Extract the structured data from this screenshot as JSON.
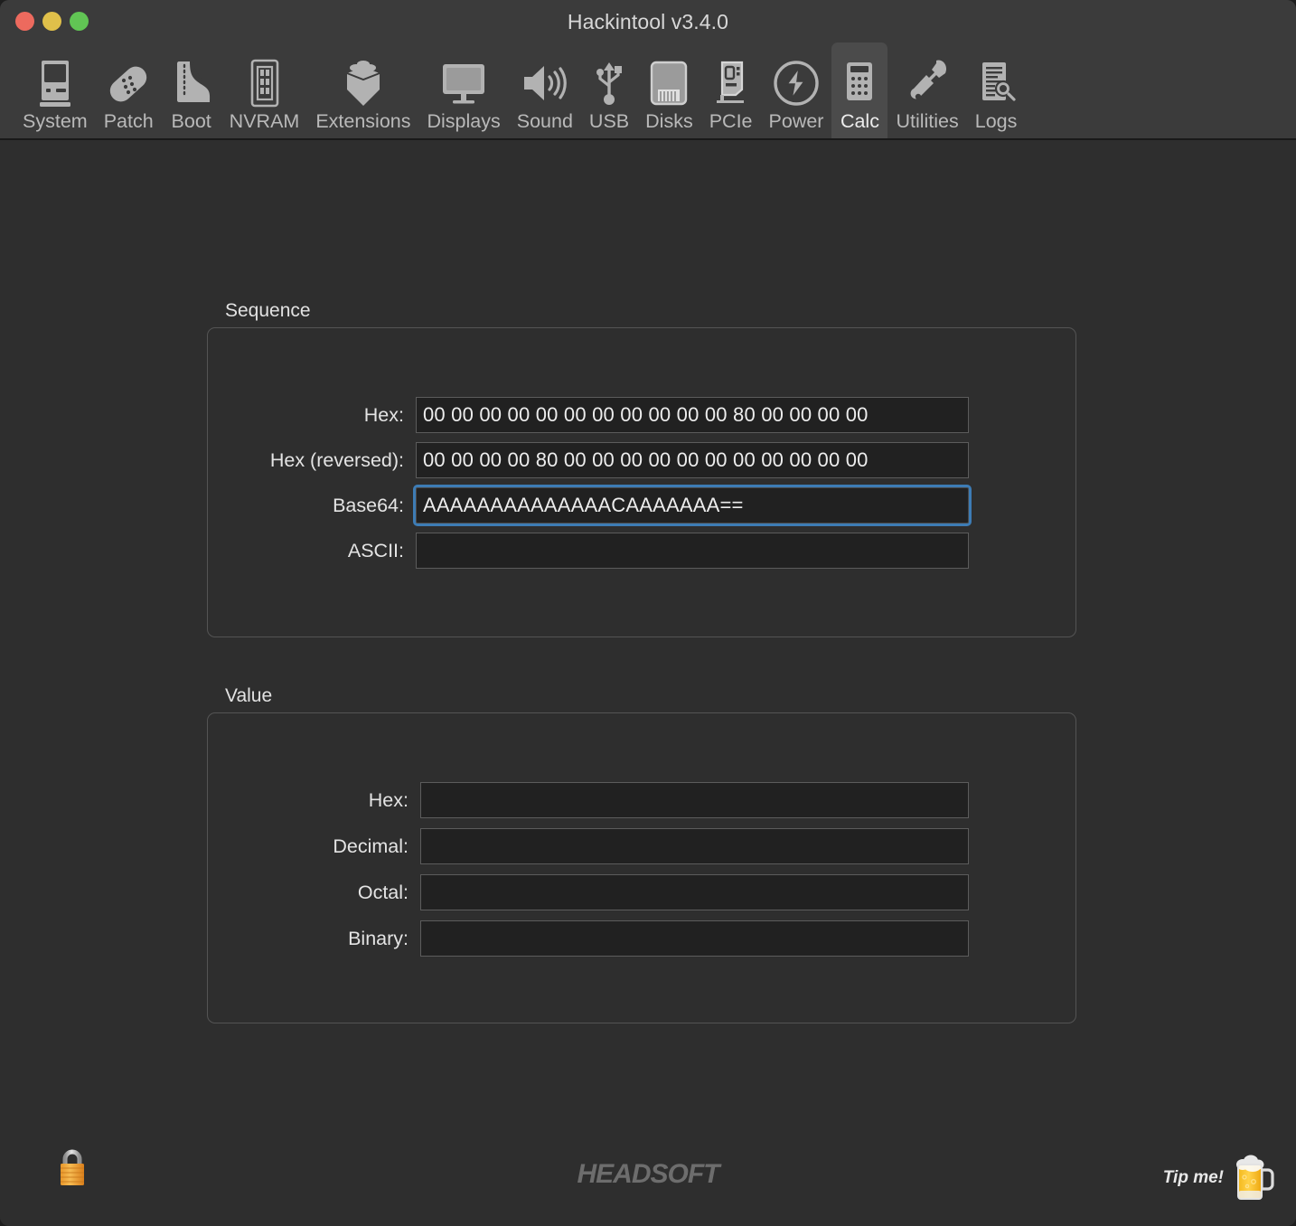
{
  "window": {
    "title": "Hackintool v3.4.0",
    "traffic_lights": [
      {
        "name": "close",
        "color": "#ed6a5e"
      },
      {
        "name": "minimize",
        "color": "#e0c04a"
      },
      {
        "name": "maximize",
        "color": "#61c554"
      }
    ]
  },
  "toolbar": {
    "active": "Calc",
    "items": [
      {
        "label": "System",
        "icon": "computer-icon"
      },
      {
        "label": "Patch",
        "icon": "bandage-icon"
      },
      {
        "label": "Boot",
        "icon": "boot-icon"
      },
      {
        "label": "NVRAM",
        "icon": "memory-chip-icon"
      },
      {
        "label": "Extensions",
        "icon": "lego-brick-icon"
      },
      {
        "label": "Displays",
        "icon": "monitor-icon"
      },
      {
        "label": "Sound",
        "icon": "speaker-icon"
      },
      {
        "label": "USB",
        "icon": "usb-icon"
      },
      {
        "label": "Disks",
        "icon": "hard-drive-icon"
      },
      {
        "label": "PCIe",
        "icon": "pcie-card-icon"
      },
      {
        "label": "Power",
        "icon": "lightning-bolt-icon"
      },
      {
        "label": "Calc",
        "icon": "calculator-icon"
      },
      {
        "label": "Utilities",
        "icon": "wrench-icon"
      },
      {
        "label": "Logs",
        "icon": "document-search-icon"
      }
    ]
  },
  "sequence": {
    "title": "Sequence",
    "rows": [
      {
        "label": "Hex:",
        "value": "00 00 00 00 00 00 00 00 00 00 00 80 00 00 00 00",
        "focused": false
      },
      {
        "label": "Hex (reversed):",
        "value": "00 00 00 00 80 00 00 00 00 00 00 00 00 00 00 00",
        "focused": false
      },
      {
        "label": "Base64:",
        "value": "AAAAAAAAAAAAAACAAAAAAA==",
        "focused": true
      },
      {
        "label": "ASCII:",
        "value": "",
        "focused": false
      }
    ]
  },
  "value": {
    "title": "Value",
    "rows": [
      {
        "label": "Hex:",
        "value": ""
      },
      {
        "label": "Decimal:",
        "value": ""
      },
      {
        "label": "Octal:",
        "value": ""
      },
      {
        "label": "Binary:",
        "value": ""
      }
    ]
  },
  "footer": {
    "lock_icon": "padlock-icon",
    "brand": "HEADSOFT",
    "tip_label": "Tip me!",
    "tip_icon": "beer-mug-icon"
  },
  "colors": {
    "window_bg": "#2e2e2e",
    "toolbar_bg": "#3b3b3b",
    "active_tab_bg": "#4b4b4b",
    "field_bg": "#212121",
    "focus_ring": "#3d7cb5",
    "text": "#e4e4e4",
    "brand": "#6d6d6d"
  }
}
